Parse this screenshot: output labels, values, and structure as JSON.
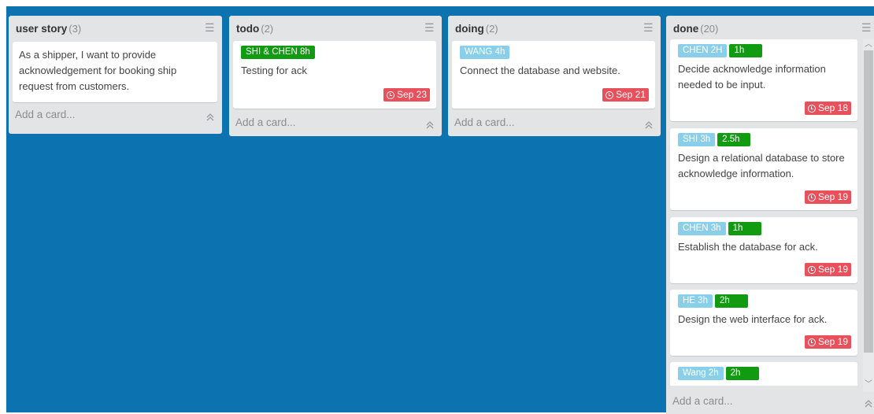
{
  "lists": [
    {
      "title": "user story",
      "count": "(3)",
      "cards": [
        {
          "text": "As a shipper, I want to provide acknowledgement for booking ship request from customers."
        }
      ],
      "add_label": "Add a card..."
    },
    {
      "title": "todo",
      "count": "(2)",
      "cards": [
        {
          "labels": [
            "SHI & CHEN 8h"
          ],
          "text": "Testing for ack",
          "due": "Sep 23"
        }
      ],
      "add_label": "Add a card..."
    },
    {
      "title": "doing",
      "count": "(2)",
      "cards": [
        {
          "labels": [
            "WANG 4h"
          ],
          "text": "Connect the database and website.",
          "due": "Sep 21"
        }
      ],
      "add_label": "Add a card..."
    },
    {
      "title": "done",
      "count": "(20)",
      "cards": [
        {
          "labels": [
            "CHEN 2H",
            "1h"
          ],
          "text": "Decide acknowledge information needed to be input.",
          "due": "Sep 18"
        },
        {
          "labels": [
            "SHI 3h",
            "2.5h"
          ],
          "text": "Design a relational database to store acknowledge information.",
          "due": "Sep 19"
        },
        {
          "labels": [
            "CHEN 3h",
            "1h"
          ],
          "text": "Establish the database for ack.",
          "due": "Sep 19"
        },
        {
          "labels": [
            "HE 3h",
            "2h"
          ],
          "text": "Design the web interface for ack.",
          "due": "Sep 19"
        },
        {
          "labels": [
            "Wang 2h",
            "2h"
          ]
        }
      ],
      "add_label": "Add a card..."
    }
  ],
  "icons": {
    "list_menu": "hamburger-menu-icon",
    "due": "clock-icon",
    "collapse": "double-chevron-up-icon"
  },
  "colors": {
    "board_bg": "#0c73b0",
    "list_bg": "#e2e4e6",
    "label_blue": "#89cfea",
    "label_green": "#109b10",
    "due_red": "#e8505b"
  }
}
